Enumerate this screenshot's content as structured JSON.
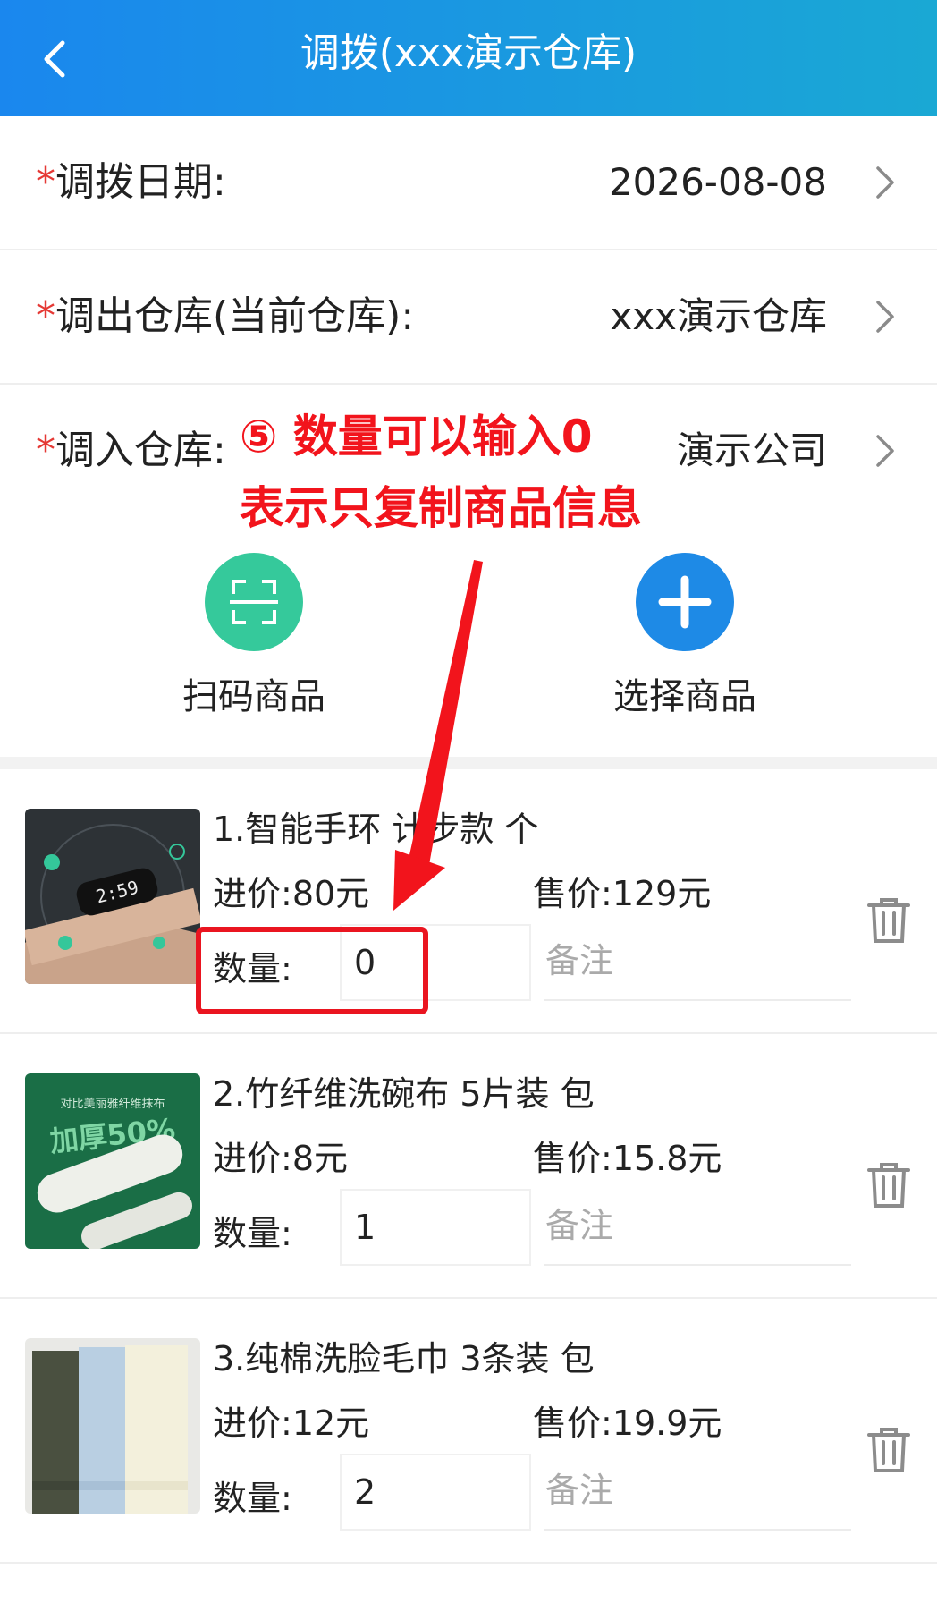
{
  "header": {
    "title": "调拨(xxx演示仓库)",
    "back_icon": "chevron-left-icon",
    "gradient": [
      "#1a87ee",
      "#1aa8d4"
    ]
  },
  "form": {
    "date": {
      "star": "*",
      "label": "调拨日期:",
      "value": "2026-08-08"
    },
    "out_warehouse": {
      "star": "*",
      "label": "调出仓库(当前仓库):",
      "value": "xxx演示仓库"
    },
    "in_warehouse": {
      "star": "*",
      "label": "调入仓库:",
      "value": "演示公司"
    }
  },
  "actions": {
    "scan": {
      "label": "扫码商品",
      "icon": "scan-icon",
      "color": "#35c99b"
    },
    "select": {
      "label": "选择商品",
      "icon": "plus-icon",
      "color": "#1e8ae6"
    }
  },
  "items": [
    {
      "name": "1.智能手环 计步款 个",
      "cost_label": "进价:",
      "cost": "80元",
      "sale_label": "售价:",
      "sale": "129元",
      "qty_label": "数量:",
      "qty": "0",
      "remark_placeholder": "备注",
      "thumb_text": "2:59"
    },
    {
      "name": "2.竹纤维洗碗布 5片装 包",
      "cost_label": "进价:",
      "cost": "8元",
      "sale_label": "售价:",
      "sale": "15.8元",
      "qty_label": "数量:",
      "qty": "1",
      "remark_placeholder": "备注",
      "thumb_text": "加厚50%",
      "thumb_caption": "对比美丽雅纤维抹布"
    },
    {
      "name": "3.纯棉洗脸毛巾 3条装 包",
      "cost_label": "进价:",
      "cost": "12元",
      "sale_label": "售价:",
      "sale": "19.9元",
      "qty_label": "数量:",
      "qty": "2",
      "remark_placeholder": "备注"
    }
  ],
  "annotation": {
    "line1": "⑤ 数量可以输入0",
    "line2": "表示只复制商品信息",
    "color": "#f2141c"
  }
}
